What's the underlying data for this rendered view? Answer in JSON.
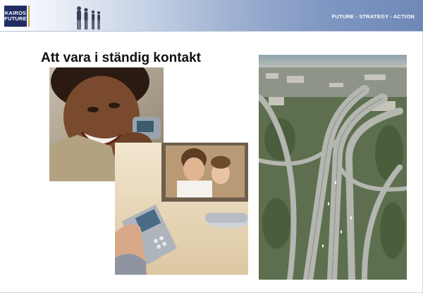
{
  "header": {
    "logo_line1": "KAIROS",
    "logo_line2": "FUTURE",
    "tagline": "FUTURE - STRATEGY - ACTION"
  },
  "slide": {
    "title": "Att vara i ständig kontakt"
  },
  "colors": {
    "logo_bg": "#1f2d63",
    "banner_dark": "#6f88b7",
    "logo_accent": "#c7a23c"
  }
}
